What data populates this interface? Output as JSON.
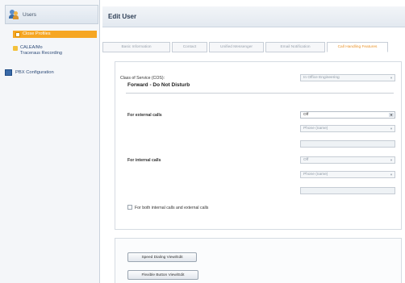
{
  "sidebar": {
    "header": "Users",
    "items": [
      {
        "label": "Close Profiles",
        "active": true
      },
      {
        "label": "CALEA/Mo\nTraceraus Recording",
        "active": false
      }
    ],
    "section": "PBX Configuration"
  },
  "main": {
    "title": "Edit User",
    "tabs": [
      {
        "label": "Basic Information",
        "active": false
      },
      {
        "label": "Contact",
        "active": false
      },
      {
        "label": "Unified Messenger",
        "active": false
      },
      {
        "label": "Email Notification",
        "active": false
      },
      {
        "label": "Call Handling Features",
        "active": true
      }
    ],
    "form": {
      "class_of_service_label": "Class of Service (COS):",
      "class_of_service_value": "In Office Engineering",
      "section_title": "Forward - Do Not Disturb",
      "external_label": "For external calls",
      "external_mode": "Off",
      "external_target": "Phone (name)",
      "internal_label": "For internal calls",
      "internal_mode": "Off",
      "internal_target": "Phone (name)",
      "both_checkbox_label": "For both internal calls and external calls",
      "speed_dial_button": "Speed Dialing View/Edit",
      "flexible_button": "Flexible Button View/Edit"
    }
  }
}
